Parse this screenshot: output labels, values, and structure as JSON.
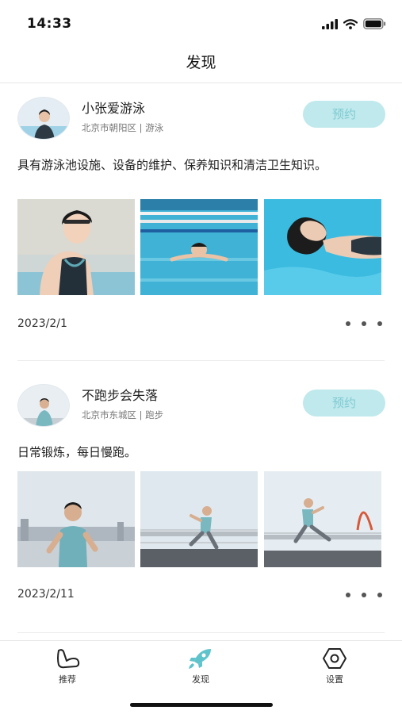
{
  "status_bar": {
    "time": "14:33"
  },
  "nav": {
    "title": "发现"
  },
  "posts": [
    {
      "name": "小张爱游泳",
      "meta": "北京市朝阳区 | 游泳",
      "button": "预约",
      "text": "具有游泳池设施、设备的维护、保养知识和清洁卫生知识。",
      "date": "2023/2/1",
      "photos": [
        "swimmer-poolside-photo",
        "swimmer-in-lanes-photo",
        "swimmer-floating-photo"
      ]
    },
    {
      "name": "不跑步会失落",
      "meta": "北京市东城区 | 跑步",
      "button": "预约",
      "text": "日常锻炼，每日慢跑。",
      "date": "2023/2/11",
      "photos": [
        "runner-riverside-photo",
        "runner-bridge-photo",
        "runner-sprint-photo"
      ]
    }
  ],
  "tabbar": {
    "items": [
      {
        "label": "推荐",
        "icon": "arm-icon"
      },
      {
        "label": "发现",
        "icon": "rocket-icon",
        "active": true
      },
      {
        "label": "设置",
        "icon": "hexagon-settings-icon"
      }
    ],
    "active_color": "#5fc3cc"
  },
  "colors": {
    "accent": "#bfe9ec",
    "accent_text": "#7ecbd3"
  }
}
